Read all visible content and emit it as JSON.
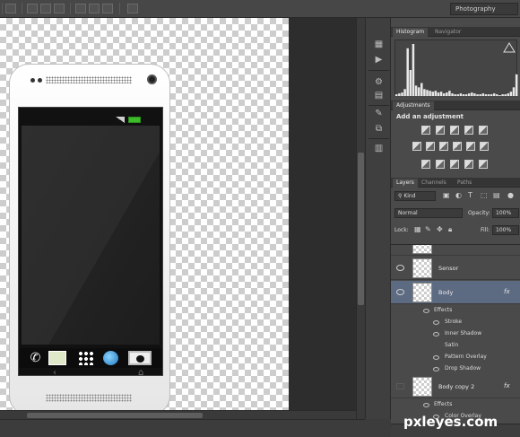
{
  "options_bar": {
    "workspace": "Photography"
  },
  "dock_icons": [
    "history-icon",
    "play-icon",
    "properties-icon",
    "brush-icon",
    "clone-source-icon",
    "swatches-icon"
  ],
  "histogram_panel": {
    "tabs": [
      "Histogram",
      "Navigator"
    ],
    "histogram_values": [
      2,
      3,
      4,
      8,
      55,
      30,
      60,
      12,
      10,
      15,
      8,
      7,
      6,
      5,
      6,
      4,
      5,
      3,
      4,
      6,
      3,
      2,
      2,
      3,
      2,
      2,
      3,
      4,
      3,
      2,
      2,
      3,
      2,
      2,
      2,
      3,
      2,
      1,
      2,
      2,
      3,
      5,
      10,
      25
    ]
  },
  "adjustments_panel": {
    "tab": "Adjustments",
    "title": "Add an adjustment"
  },
  "layers_panel": {
    "tabs": [
      "Layers",
      "Channels",
      "Paths"
    ],
    "filter": "Kind",
    "blend_mode": "Normal",
    "opacity_label": "Opacity:",
    "opacity": "100%",
    "lock_label": "Lock:",
    "fill_label": "Fill:",
    "fill": "100%",
    "layers": [
      {
        "name": "Sensor",
        "visible": true,
        "fx": false,
        "selected": false
      },
      {
        "name": "Body",
        "visible": true,
        "fx": true,
        "selected": true,
        "effects_label": "Effects",
        "effects": [
          {
            "name": "Stroke",
            "visible": true
          },
          {
            "name": "Inner Shadow",
            "visible": true
          },
          {
            "name": "Satin",
            "visible": false
          },
          {
            "name": "Pattern Overlay",
            "visible": true
          },
          {
            "name": "Drop Shadow",
            "visible": true
          }
        ]
      },
      {
        "name": "Body copy 2",
        "visible": false,
        "fx": true,
        "selected": false,
        "effects_label": "Effects",
        "effects": [
          {
            "name": "Color Overlay",
            "visible": true
          }
        ]
      }
    ],
    "fx_label": "fx"
  },
  "phone": {
    "nav_back": "‹",
    "nav_home": "⌂",
    "phone_glyph": "✆"
  },
  "watermark": "pxleyes.com"
}
